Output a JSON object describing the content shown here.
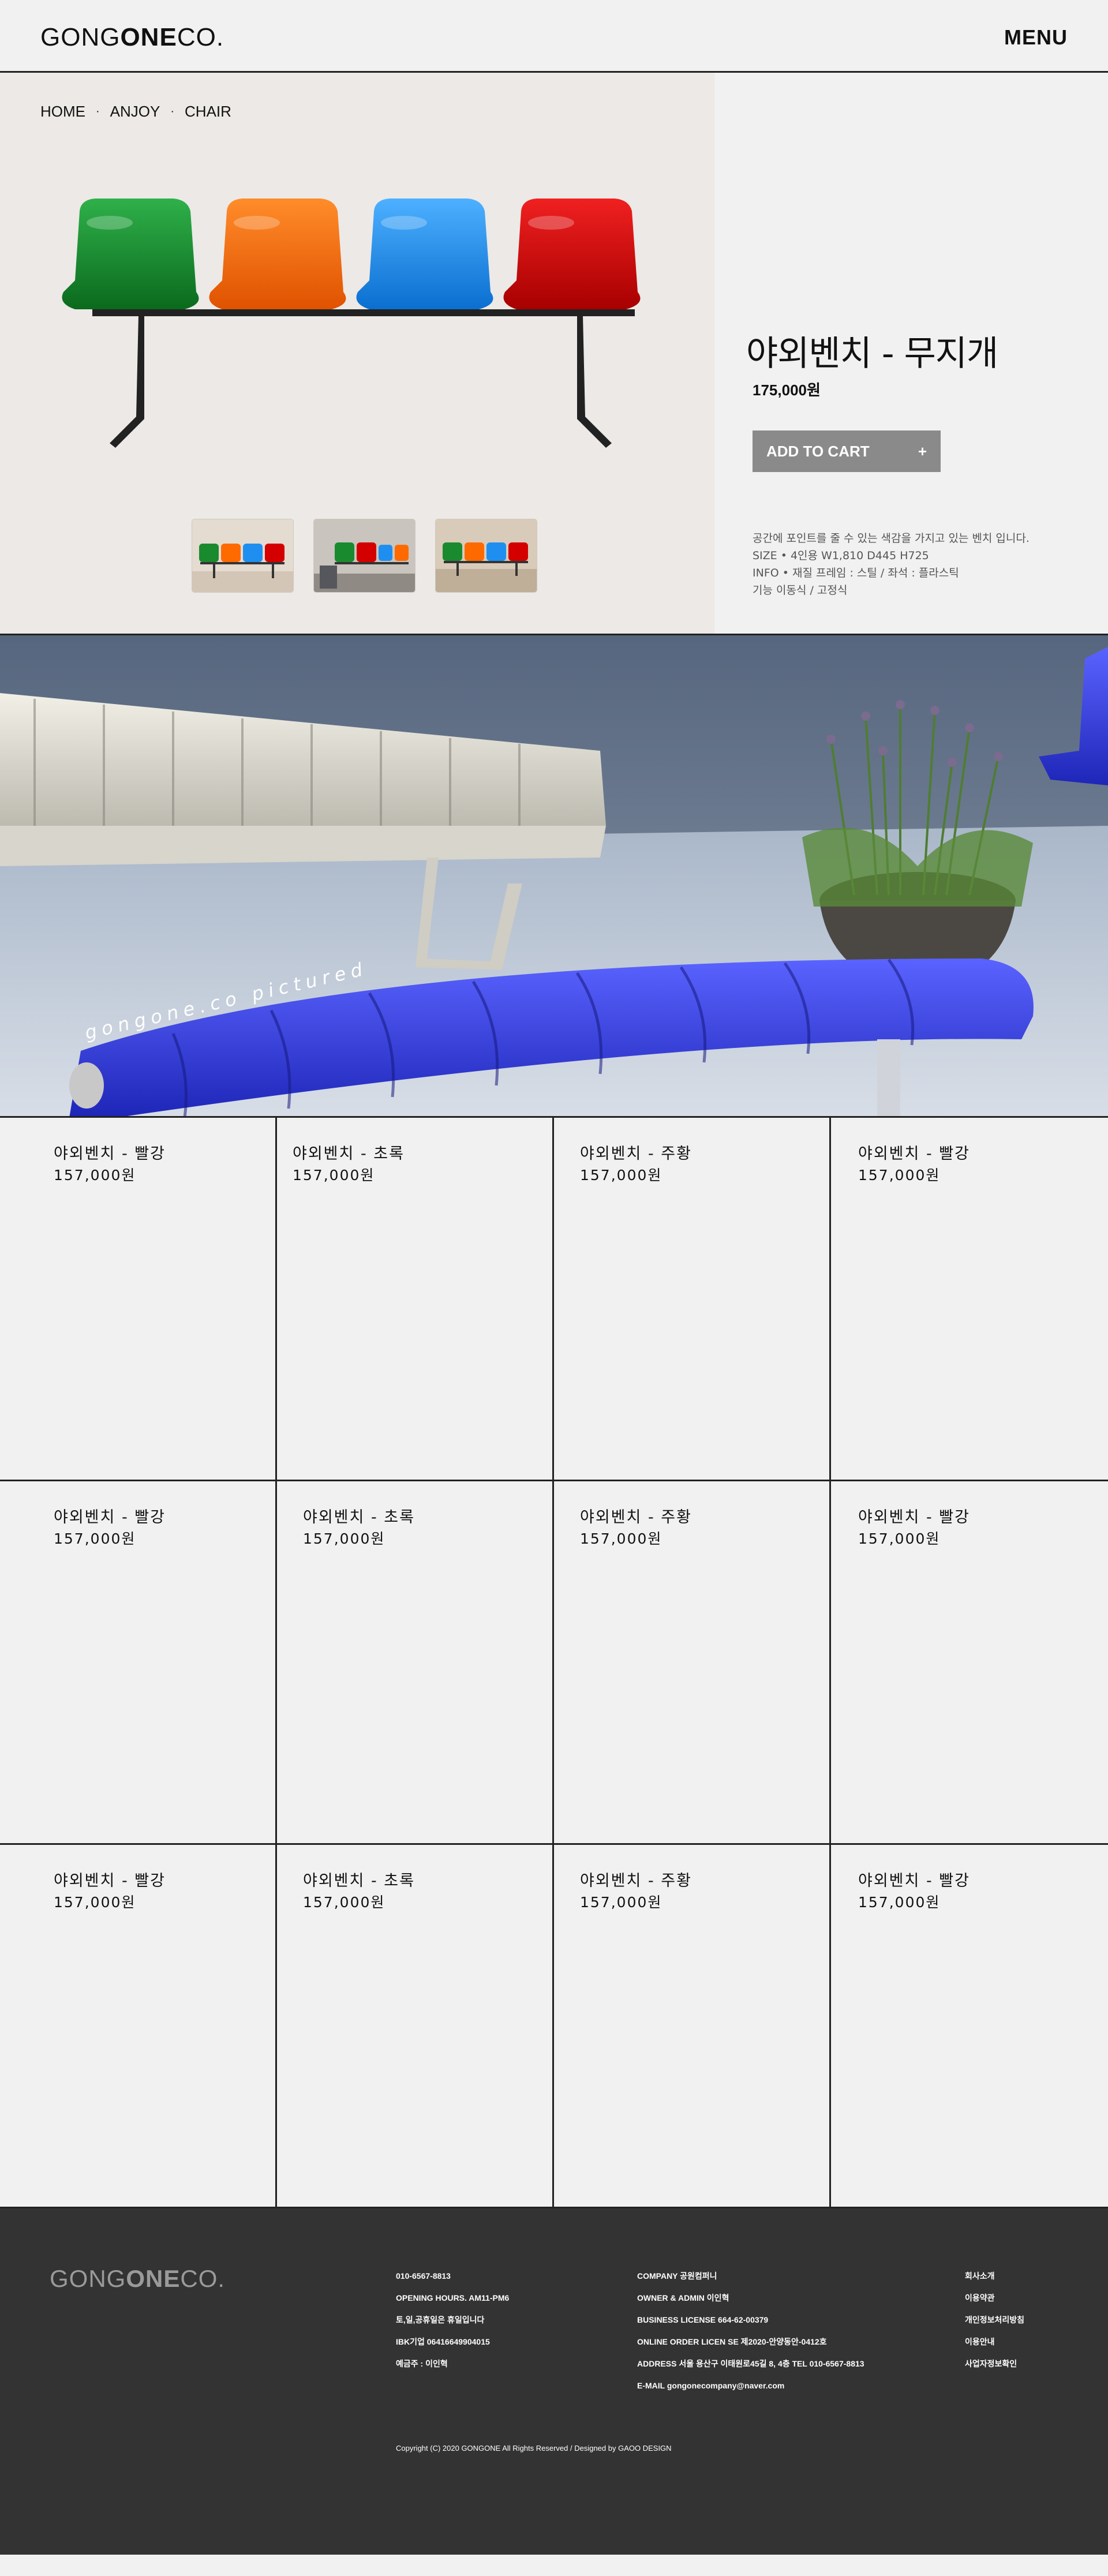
{
  "header": {
    "logo_light_1": "GONG",
    "logo_bold": "ONE",
    "logo_light_2": "CO.",
    "menu_label": "MENU"
  },
  "breadcrumb": [
    "HOME",
    "ANJOY",
    "CHAIR"
  ],
  "breadcrumb_sep": "·",
  "product": {
    "title": "야외벤치 - 무지개",
    "price": "175,000원",
    "cart_label": "ADD TO CART",
    "cart_icon": "+",
    "description": [
      "공간에 포인트를 줄 수 있는  색감을 가지고 있는 벤치 입니다.",
      "SIZE • 4인용 W1,810 D445 H725",
      "INFO • 재질 프레임 : 스틸 / 좌석 : 플라스틱",
      "기능 이동식 / 고정식"
    ],
    "seat_colors": [
      "#1a8a2e",
      "#ff6a00",
      "#1e8ff0",
      "#d40000"
    ]
  },
  "banner": {
    "caption": "gongone.co pictured"
  },
  "grid": {
    "items": [
      {
        "name": "야외벤치 - 빨강",
        "price": "157,000원"
      },
      {
        "name": "야외벤치 - 초록",
        "price": "157,000원"
      },
      {
        "name": "야외벤치 - 주황",
        "price": "157,000원"
      },
      {
        "name": "야외벤치 - 빨강",
        "price": "157,000원"
      },
      {
        "name": "야외벤치 - 빨강",
        "price": "157,000원"
      },
      {
        "name": "야외벤치 - 초록",
        "price": "157,000원"
      },
      {
        "name": "야외벤치 - 주황",
        "price": "157,000원"
      },
      {
        "name": "야외벤치 - 빨강",
        "price": "157,000원"
      },
      {
        "name": "야외벤치 - 빨강",
        "price": "157,000원"
      },
      {
        "name": "야외벤치 - 초록",
        "price": "157,000원"
      },
      {
        "name": "야외벤치 - 주황",
        "price": "157,000원"
      },
      {
        "name": "야외벤치 - 빨강",
        "price": "157,000원"
      }
    ]
  },
  "footer": {
    "logo_light_1": "GONG",
    "logo_bold": "ONE",
    "logo_light_2": "CO.",
    "col1": [
      "010-6567-8813",
      "OPENING HOURS. AM11-PM6",
      "토,일,공휴일은 휴일입니다",
      "IBK기업 06416649904015",
      "예금주 : 이인혁"
    ],
    "col2": [
      "COMPANY 공원컴퍼니",
      "OWNER & ADMIN 이인혁",
      "BUSINESS LICENSE 664-62-00379",
      "ONLINE ORDER LICEN SE 제2020-안양동안-0412호",
      "ADDRESS 서울 용산구 이태원로45길 8, 4층 TEL 010-6567-8813",
      "E-MAIL gongonecompany@naver.com"
    ],
    "col3": [
      "회사소개",
      "이용약관",
      "개인정보처리방침",
      "이용안내",
      "사업자정보확인"
    ],
    "copyright": "Copyright (C) 2020 GONGONE All Rights Reserved / Designed by GAOO DESIGN"
  }
}
